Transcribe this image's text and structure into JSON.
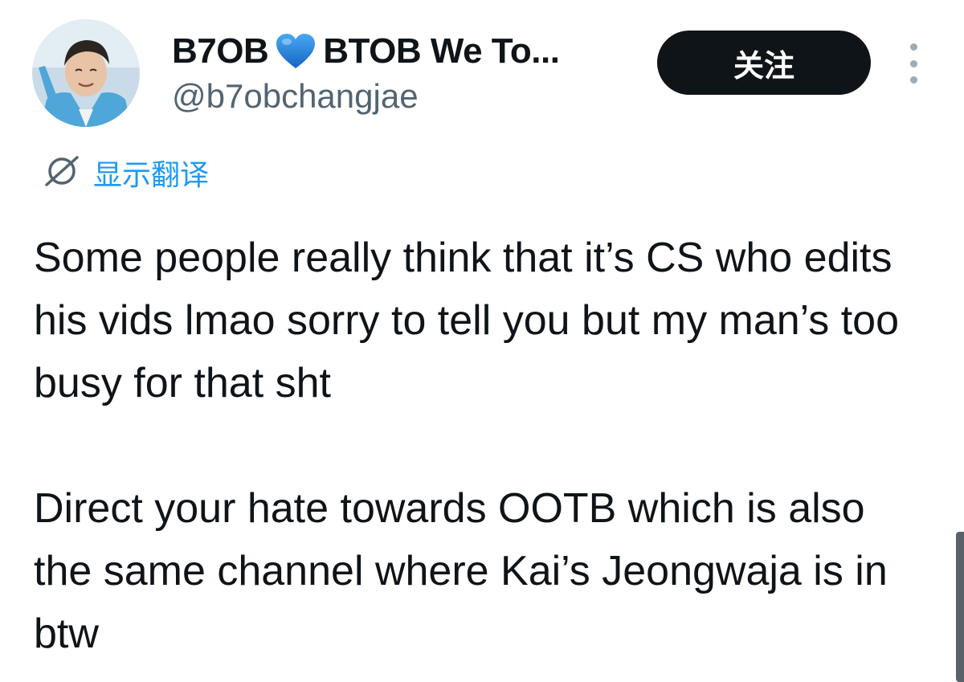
{
  "tweet": {
    "author": {
      "display_name": "B7OB",
      "display_name_suffix": "BTOB We To...",
      "heart_icon": "blue-heart-icon",
      "handle": "@b7obchangjae",
      "avatar_icon": "profile-photo"
    },
    "follow_label": "关注",
    "more_icon": "more-vertical-icon",
    "translate": {
      "icon": "translate-globe-icon",
      "label": "显示翻译"
    },
    "body": {
      "paragraph_1": "Some people really think that it’s CS who edits his vids lmao sorry to tell you but my man’s too busy for that sht",
      "paragraph_2": "Direct your hate towards OOTB which is also the same channel where Kai’s Jeongwaja is in btw"
    }
  },
  "colors": {
    "text_primary": "#0f1419",
    "text_secondary": "#536471",
    "accent_blue": "#1d9bf0",
    "heart_blue": "#1d7fd8",
    "button_bg": "#0f1419",
    "button_text": "#ffffff"
  }
}
